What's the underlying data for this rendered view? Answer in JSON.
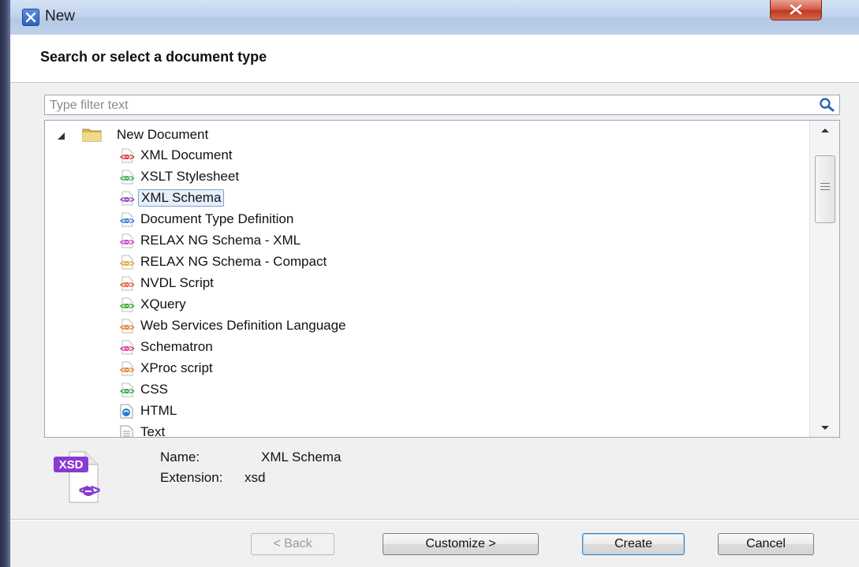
{
  "window": {
    "title": "New",
    "header": "Search or select a document type"
  },
  "filter": {
    "placeholder": "Type filter text"
  },
  "tree": {
    "root_label": "New Document",
    "items": [
      {
        "label": "XML Document",
        "icon": "xml-document-icon",
        "color": "#e0302a"
      },
      {
        "label": "XSLT Stylesheet",
        "icon": "xslt-stylesheet-icon",
        "color": "#3aa84a"
      },
      {
        "label": "XML Schema",
        "icon": "xml-schema-icon",
        "color": "#8a3ad0",
        "selected": true
      },
      {
        "label": "Document Type Definition",
        "icon": "dtd-icon",
        "color": "#2a7ad8"
      },
      {
        "label": "RELAX NG Schema - XML",
        "icon": "relax-ng-xml-icon",
        "color": "#c83ad0"
      },
      {
        "label": "RELAX NG Schema - Compact",
        "icon": "relax-ng-compact-icon",
        "color": "#e8a030"
      },
      {
        "label": "NVDL Script",
        "icon": "nvdl-script-icon",
        "color": "#e85a20"
      },
      {
        "label": "XQuery",
        "icon": "xquery-icon",
        "color": "#28a828"
      },
      {
        "label": "Web Services Definition Language",
        "icon": "wsdl-icon",
        "color": "#e87a20"
      },
      {
        "label": "Schematron",
        "icon": "schematron-icon",
        "color": "#e0308a"
      },
      {
        "label": "XProc script",
        "icon": "xproc-script-icon",
        "color": "#e8802a"
      },
      {
        "label": "CSS",
        "icon": "css-icon",
        "color": "#28a850"
      },
      {
        "label": "HTML",
        "icon": "html-icon",
        "color": "#2a7ad8"
      },
      {
        "label": "Text",
        "icon": "text-file-icon",
        "color": "#888888"
      }
    ]
  },
  "info": {
    "badge": "XSD",
    "name_label": "Name:",
    "name_value": "XML Schema",
    "extension_label": "Extension:",
    "extension_value": "xsd"
  },
  "buttons": {
    "back": "< Back",
    "customize": "Customize >",
    "create": "Create",
    "cancel": "Cancel"
  }
}
